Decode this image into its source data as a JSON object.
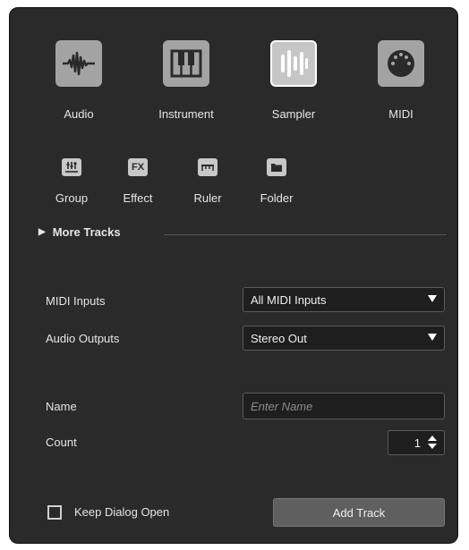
{
  "track_types": [
    {
      "label": "Audio",
      "icon": "audio-waveform-icon",
      "selected": false
    },
    {
      "label": "Instrument",
      "icon": "piano-keys-icon",
      "selected": false
    },
    {
      "label": "Sampler",
      "icon": "sampler-bars-icon",
      "selected": true
    },
    {
      "label": "MIDI",
      "icon": "midi-connector-icon",
      "selected": false
    }
  ],
  "other_types": [
    {
      "label": "Group",
      "icon": "group-fader-icon"
    },
    {
      "label": "Effect",
      "icon": "fx-icon",
      "text": "FX"
    },
    {
      "label": "Ruler",
      "icon": "ruler-icon"
    },
    {
      "label": "Folder",
      "icon": "folder-icon"
    }
  ],
  "more_tracks": {
    "label": "More Tracks"
  },
  "fields": {
    "midi_inputs": {
      "label": "MIDI Inputs",
      "value": "All MIDI Inputs"
    },
    "audio_outputs": {
      "label": "Audio Outputs",
      "value": "Stereo Out"
    },
    "name": {
      "label": "Name",
      "value": "",
      "placeholder": "Enter Name"
    },
    "count": {
      "label": "Count",
      "value": "1"
    }
  },
  "footer": {
    "keep_open_label": "Keep Dialog Open",
    "keep_open_checked": false,
    "add_button_label": "Add Track"
  },
  "colors": {
    "background": "#2a2a2a",
    "tile": "#a3a3a3",
    "tile_selected": "#c6c6c6",
    "field_bg": "#1e1e1e"
  }
}
